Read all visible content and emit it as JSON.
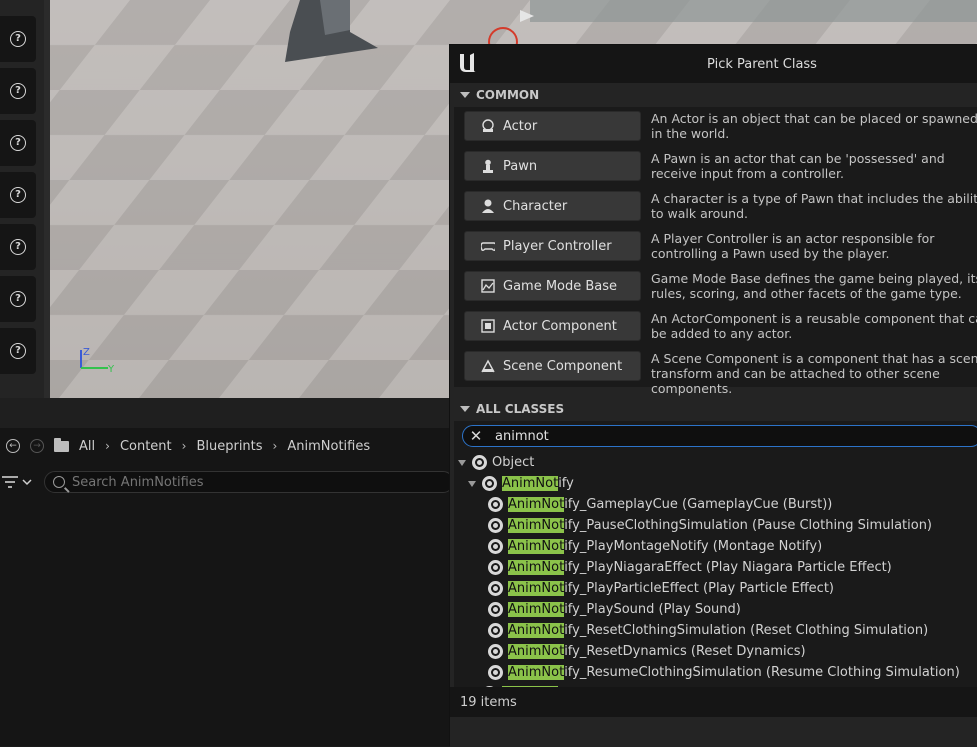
{
  "viewport": {
    "toolbar_buttons": [
      "?",
      "?",
      "?",
      "?",
      "?",
      "?",
      "?"
    ],
    "axis": {
      "z": "Z",
      "y": "Y"
    }
  },
  "content_browser": {
    "breadcrumb": [
      "All",
      "Content",
      "Blueprints",
      "AnimNotifies"
    ],
    "search_placeholder": "Search AnimNotifies"
  },
  "dialog": {
    "title": "Pick Parent Class",
    "common": {
      "header": "COMMON",
      "items": [
        {
          "label": "Actor",
          "icon": "actor-icon",
          "desc": "An Actor is an object that can be placed or spawned in the world."
        },
        {
          "label": "Pawn",
          "icon": "pawn-icon",
          "desc": "A Pawn is an actor that can be 'possessed' and receive input from a controller."
        },
        {
          "label": "Character",
          "icon": "character-icon",
          "desc": "A character is a type of Pawn that includes the ability to walk around."
        },
        {
          "label": "Player Controller",
          "icon": "gamepad-icon",
          "desc": "A Player Controller is an actor responsible for controlling a Pawn used by the player."
        },
        {
          "label": "Game Mode Base",
          "icon": "game-mode-icon",
          "desc": "Game Mode Base defines the game being played, its rules, scoring, and other facets of the game type."
        },
        {
          "label": "Actor Component",
          "icon": "actor-component-icon",
          "desc": "An ActorComponent is a reusable component that can be added to any actor."
        },
        {
          "label": "Scene Component",
          "icon": "scene-component-icon",
          "desc": "A Scene Component is a component that has a scene transform and can be attached to other scene components."
        }
      ]
    },
    "all_classes": {
      "header": "ALL CLASSES",
      "search_value": "animnot",
      "highlight": "AnimNot",
      "tree": [
        {
          "label": "Object",
          "level": 0,
          "expandable": true
        },
        {
          "label": "AnimNotify",
          "level": 1,
          "expandable": true
        },
        {
          "label": "AnimNotify_GameplayCue (GameplayCue (Burst))",
          "level": 2,
          "expandable": false
        },
        {
          "label": "AnimNotify_PauseClothingSimulation (Pause Clothing Simulation)",
          "level": 2,
          "expandable": false
        },
        {
          "label": "AnimNotify_PlayMontageNotify (Montage Notify)",
          "level": 2,
          "expandable": false
        },
        {
          "label": "AnimNotify_PlayNiagaraEffect (Play Niagara Particle Effect)",
          "level": 2,
          "expandable": false
        },
        {
          "label": "AnimNotify_PlayParticleEffect (Play Particle Effect)",
          "level": 2,
          "expandable": false
        },
        {
          "label": "AnimNotify_PlaySound (Play Sound)",
          "level": 2,
          "expandable": false
        },
        {
          "label": "AnimNotify_ResetClothingSimulation (Reset Clothing Simulation)",
          "level": 2,
          "expandable": false
        },
        {
          "label": "AnimNotify_ResetDynamics (Reset Dynamics)",
          "level": 2,
          "expandable": false
        },
        {
          "label": "AnimNotify_ResumeClothingSimulation (Resume Clothing Simulation)",
          "level": 2,
          "expandable": false
        },
        {
          "label": "AnimNotifyState",
          "level": 1,
          "expandable": true
        }
      ],
      "status": "19 items"
    }
  },
  "colors": {
    "highlight": "#8bc34a",
    "search_focus": "#2c73c9"
  }
}
